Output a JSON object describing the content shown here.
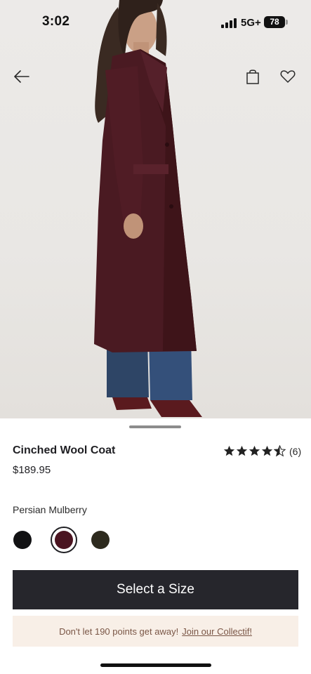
{
  "status_bar": {
    "time": "3:02",
    "network": "5G+",
    "battery": "78"
  },
  "nav": {
    "back_icon": "arrow-left-icon",
    "bag_icon": "shopping-bag-icon",
    "favorite_icon": "heart-icon"
  },
  "hero": {
    "image": "model-wearing-coat-photo"
  },
  "product": {
    "title": "Cinched Wool Coat",
    "price": "$189.95",
    "rating": 4.5,
    "review_count": "(6)",
    "color_name": "Persian Mulberry",
    "swatches": [
      {
        "name": "black",
        "color": "#111113",
        "selected": false
      },
      {
        "name": "persian-mulberry",
        "color": "#4a1420",
        "selected": true
      },
      {
        "name": "olive",
        "color": "#2d2a1e",
        "selected": false
      }
    ]
  },
  "actions": {
    "select_size": "Select a Size"
  },
  "promo": {
    "text": "Don't let 190 points get away!",
    "link": "Join our Collectif!"
  },
  "colors": {
    "primary_button": "#26262c",
    "promo_bg": "#f8efe7",
    "promo_text": "#7a5646"
  }
}
